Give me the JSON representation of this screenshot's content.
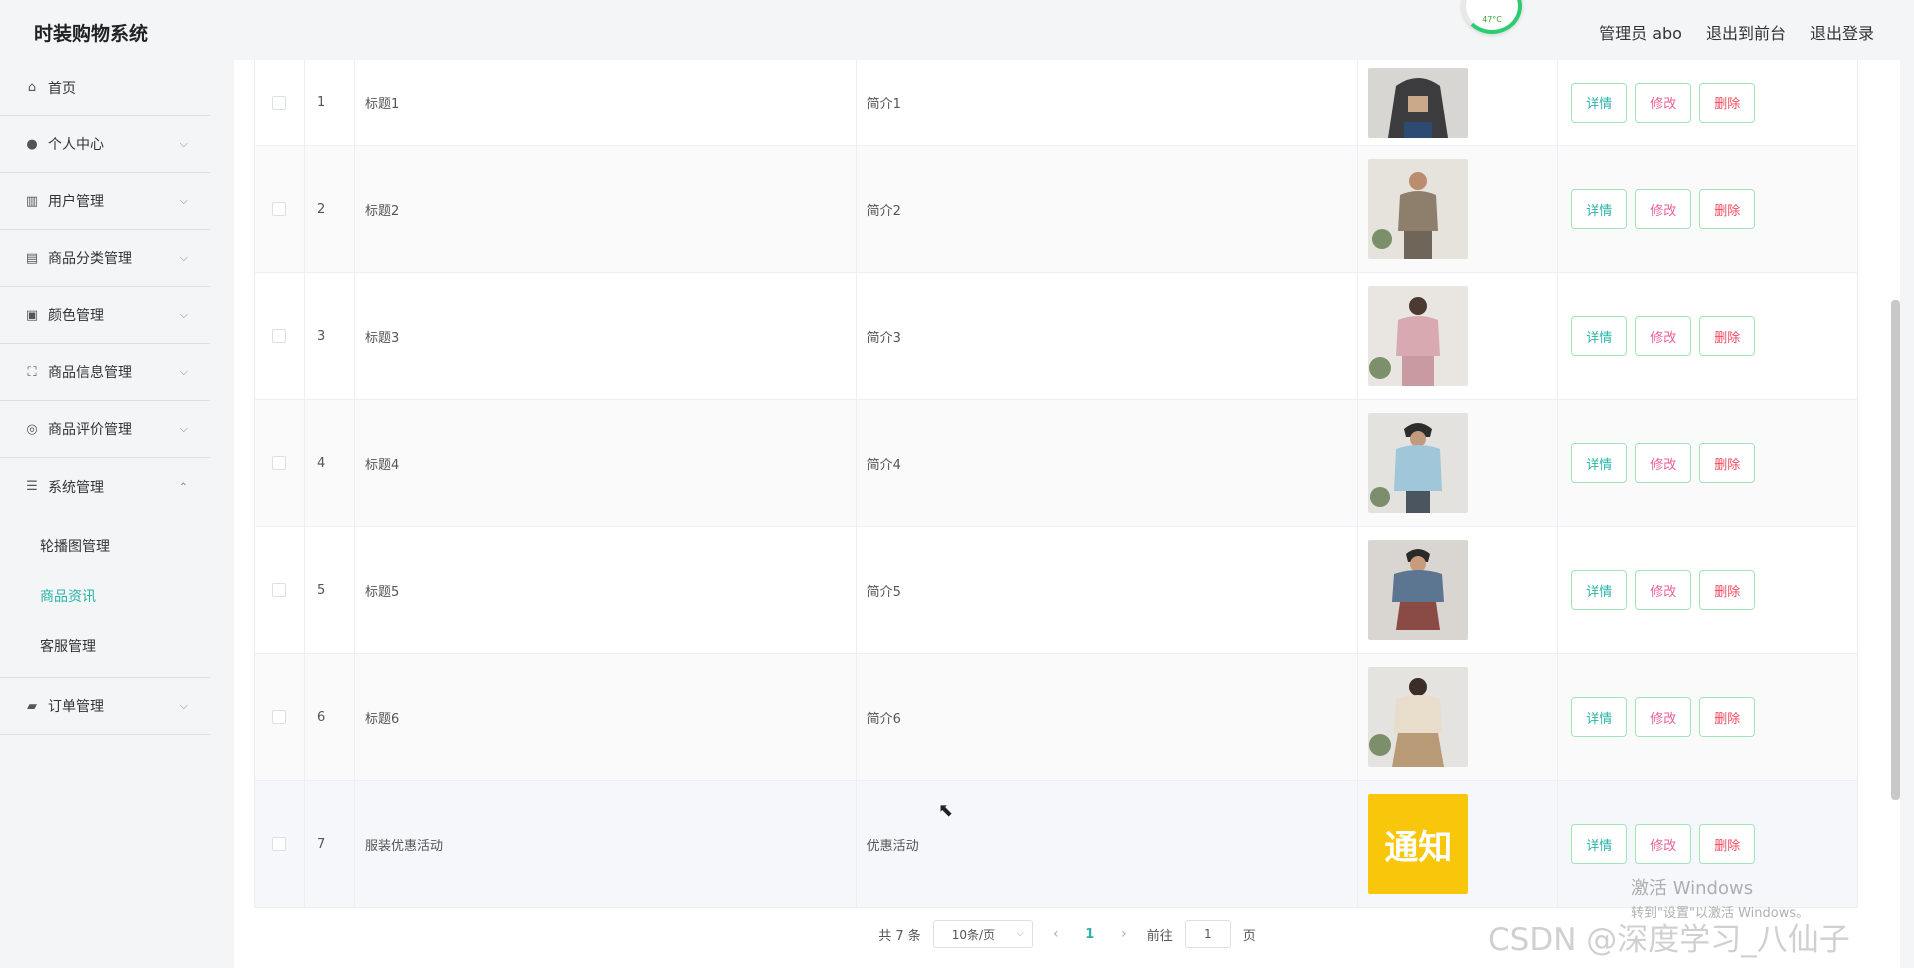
{
  "app": {
    "title": "时装购物系统"
  },
  "header": {
    "user": "管理员 abo",
    "to_front": "退出到前台",
    "logout": "退出登录",
    "temp": "47°C"
  },
  "sidebar": {
    "items": [
      {
        "label": "首页",
        "icon": "home-icon"
      },
      {
        "label": "个人中心",
        "icon": "user-icon"
      },
      {
        "label": "用户管理",
        "icon": "users-icon"
      },
      {
        "label": "商品分类管理",
        "icon": "briefcase-icon"
      },
      {
        "label": "颜色管理",
        "icon": "clipboard-icon"
      },
      {
        "label": "商品信息管理",
        "icon": "fullscreen-icon"
      },
      {
        "label": "商品评价管理",
        "icon": "compass-icon"
      },
      {
        "label": "系统管理",
        "icon": "menu-icon"
      },
      {
        "label": "订单管理",
        "icon": "ticket-icon"
      }
    ],
    "system_sub": [
      {
        "label": "轮播图管理"
      },
      {
        "label": "商品资讯"
      },
      {
        "label": "客服管理"
      }
    ]
  },
  "table": {
    "rows": [
      {
        "idx": "1",
        "title": "标题1",
        "intro": "简介1"
      },
      {
        "idx": "2",
        "title": "标题2",
        "intro": "简介2"
      },
      {
        "idx": "3",
        "title": "标题3",
        "intro": "简介3"
      },
      {
        "idx": "4",
        "title": "标题4",
        "intro": "简介4"
      },
      {
        "idx": "5",
        "title": "标题5",
        "intro": "简介5"
      },
      {
        "idx": "6",
        "title": "标题6",
        "intro": "简介6"
      },
      {
        "idx": "7",
        "title": "服装优惠活动",
        "intro": "优惠活动",
        "image_text": "通知"
      }
    ],
    "actions": {
      "detail": "详情",
      "edit": "修改",
      "delete": "删除"
    }
  },
  "pagination": {
    "total": "共 7 条",
    "page_size": "10条/页",
    "current": "1",
    "goto_label": "前往",
    "goto_value": "1",
    "page_suffix": "页"
  },
  "watermark": {
    "line1": "激活 Windows",
    "line2": "转到\"设置\"以激活 Windows。",
    "csdn": "CSDN @深度学习_八仙子"
  }
}
